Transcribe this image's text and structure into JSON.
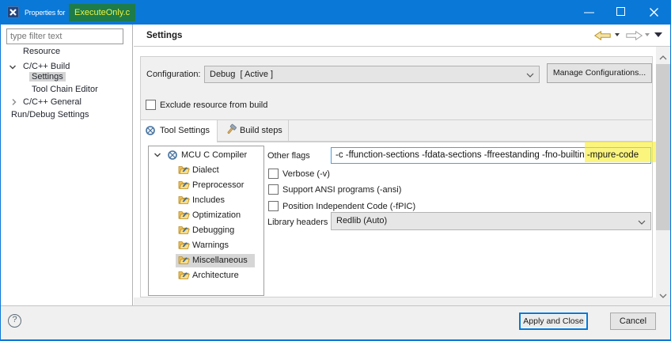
{
  "window": {
    "title_prefix": "Properties for ",
    "title_file": "ExecuteOnly.c"
  },
  "colors": {
    "accent_blue": "#0078d7",
    "title_highlight_green": "#1d7c49",
    "title_highlight_text": "#edf23f",
    "flag_highlight_yellow": "#f7ee32",
    "selection_gray": "#d6d6d6",
    "focus_field_border": "#4e9de0"
  },
  "sidebar": {
    "filter_placeholder": "type filter text",
    "items": [
      "Resource",
      "C/C++ Build",
      "Settings",
      "Tool Chain Editor",
      "C/C++ General",
      "Run/Debug Settings"
    ]
  },
  "header": {
    "title": "Settings"
  },
  "config": {
    "label": "Configuration:",
    "value": "Debug  [ Active ]",
    "manage_button": "Manage Configurations...",
    "exclude_checkbox": "Exclude resource from build"
  },
  "tabs": [
    {
      "label": "Tool Settings"
    },
    {
      "label": "Build steps"
    }
  ],
  "tool_tree": {
    "root": "MCU C Compiler",
    "children": [
      "Dialect",
      "Preprocessor",
      "Includes",
      "Optimization",
      "Debugging",
      "Warnings",
      "Miscellaneous",
      "Architecture"
    ],
    "selected": "Miscellaneous"
  },
  "misc_panel": {
    "other_flags_label": "Other flags",
    "other_flags_value_pre": "-c -ffunction-sections -fdata-sections -ffreestanding -fno-builtin ",
    "other_flags_value_highlight": "-mpure-code",
    "checkboxes": [
      "Verbose (-v)",
      "Support ANSI programs (-ansi)",
      "Position Independent Code (-fPIC)"
    ],
    "library_headers_label": "Library headers",
    "library_headers_value": "Redlib (Auto)"
  },
  "footer": {
    "apply_button": "Apply and Close",
    "cancel_button": "Cancel"
  }
}
